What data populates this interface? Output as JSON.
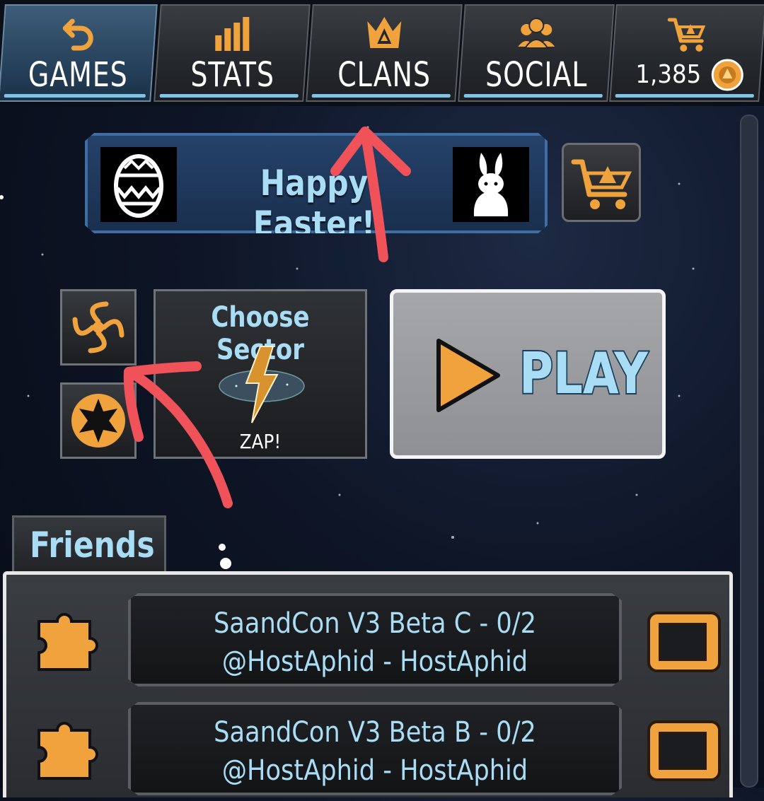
{
  "tabs": [
    {
      "label": "GAMES",
      "icon": "undo-arrow-icon",
      "active": true
    },
    {
      "label": "STATS",
      "icon": "bar-chart-icon",
      "active": false
    },
    {
      "label": "CLANS",
      "icon": "crown-icon",
      "active": false
    },
    {
      "label": "SOCIAL",
      "icon": "people-icon",
      "active": false
    }
  ],
  "store": {
    "coins": "1,385",
    "icon": "cart-icon"
  },
  "banner": {
    "title": "Happy Easter!"
  },
  "sector": {
    "title": "Choose Sector",
    "subtitle": "ZAP!"
  },
  "play": {
    "label": "PLAY"
  },
  "friends": {
    "title": "Friends",
    "games": [
      {
        "line1": "SaandCon V3 Beta C - 0/2",
        "line2": "@HostAphid - HostAphid"
      },
      {
        "line1": "SaandCon V3 Beta B - 0/2",
        "line2": "@HostAphid - HostAphid"
      }
    ]
  },
  "colors": {
    "accent": "#f0a23c",
    "text": "#a9dcf5",
    "annotation": "#f0525a"
  }
}
